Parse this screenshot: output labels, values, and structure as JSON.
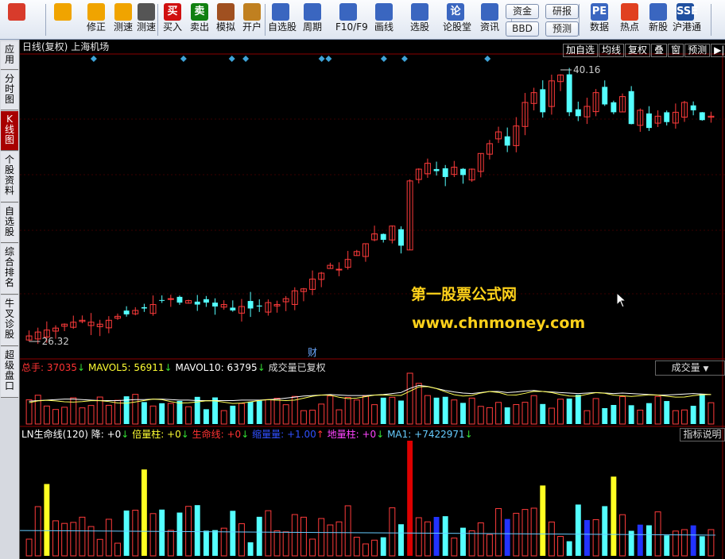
{
  "toolbar": {
    "items": [
      {
        "label": "",
        "icon": "home-icon",
        "color": "#d83b2b"
      },
      {
        "label": "",
        "icon": "back-arrow-icon",
        "color": "#f0a400"
      },
      {
        "label": "修正",
        "icon": "updown-arrows-icon",
        "color": "#f0a400"
      },
      {
        "label": "测速",
        "icon": "speed-icon",
        "color": "#f0a400"
      },
      {
        "label": "测速",
        "icon": "clock-icon",
        "color": "#555555"
      },
      {
        "label": "买入",
        "icon": "buy-icon",
        "text": "买",
        "color": "#d01010"
      },
      {
        "label": "卖出",
        "icon": "sell-icon",
        "text": "卖",
        "color": "#108010"
      },
      {
        "label": "模拟",
        "icon": "hammer-icon",
        "color": "#a05020"
      },
      {
        "label": "开户",
        "icon": "lock-icon",
        "color": "#c08020"
      },
      {
        "label": "自选股",
        "icon": "star-icon",
        "color": "#3a66c0"
      },
      {
        "label": "周期",
        "icon": "period-icon",
        "color": "#3a66c0"
      },
      {
        "label": "F10/F9",
        "icon": "f10-icon",
        "color": "#3a66c0"
      },
      {
        "label": "画线",
        "icon": "pencil-icon",
        "color": "#3a66c0"
      },
      {
        "label": "选股",
        "icon": "select-stock-icon",
        "color": "#3a66c0"
      },
      {
        "label": "论股堂",
        "icon": "forum-icon",
        "text": "论",
        "color": "#3a66c0"
      },
      {
        "label": "资讯",
        "icon": "news-icon",
        "color": "#3a66c0"
      },
      {
        "label": "数据",
        "icon": "pe-icon",
        "text": "PE",
        "color": "#3a66c0"
      },
      {
        "label": "热点",
        "icon": "hot-icon",
        "color": "#e04020"
      },
      {
        "label": "新股",
        "icon": "new-stock-icon",
        "color": "#3a66c0"
      },
      {
        "label": "沪港通",
        "icon": "sse-hkex-icon",
        "text": "SSE",
        "color": "#2050a0"
      }
    ],
    "pills": [
      "资金",
      "BBD",
      "研报",
      "预测"
    ]
  },
  "left_tabs": [
    "应用",
    "分时图",
    "K线图",
    "个股资料",
    "自选股",
    "综合排名",
    "牛叉诊股",
    "超级盘口"
  ],
  "chart_header": {
    "period": "日线(复权)",
    "stock": "上海机场"
  },
  "chart_buttons": [
    "加自选",
    "均线",
    "复权",
    "叠",
    "窗",
    "预测"
  ],
  "price_labels": {
    "high": "40.16",
    "low": "26.32"
  },
  "watermark": {
    "line1": "第一股票公式网",
    "line2": "www.chnmoney.com"
  },
  "event_marker": "财",
  "volume_header": {
    "total_label": "总手: ",
    "total": "37035",
    "total_arrow": "↓",
    "mavol5_label": "MAVOL5: ",
    "mavol5": "56911",
    "mavol5_arrow": "↓",
    "mavol10_label": "MAVOL10: ",
    "mavol10": "63795",
    "mavol10_arrow": "↓",
    "note": "成交量已复权",
    "select": "成交量"
  },
  "indicator_header": {
    "name": "LN生命线(120) 降: +0",
    "a1": "↓",
    "beiliang_label": "倍量柱: ",
    "beiliang": "+0",
    "a2": "↓",
    "life_label": "生命线: ",
    "life": "+0",
    "a3": "↓",
    "suoliang_label": "缩量量: ",
    "suoliang": "+1.00",
    "a4": "↑",
    "diliang_label": "地量柱: ",
    "diliang": "+0",
    "a5": "↓",
    "ma1_label": "MA1: ",
    "ma1": "+7422971",
    "a6": "↓",
    "help": "指标说明"
  },
  "chart_data": {
    "type": "candlestick",
    "high": 40.16,
    "low": 26.32,
    "close": [
      26.6,
      26.8,
      26.9,
      27.0,
      27.2,
      27.3,
      27.4,
      27.3,
      27.2,
      27.4,
      27.6,
      27.7,
      27.9,
      28.0,
      28.2,
      28.4,
      28.5,
      28.3,
      28.4,
      28.2,
      28.3,
      28.1,
      28.2,
      27.9,
      28.1,
      28.0,
      28.1,
      28.3,
      28.2,
      28.5,
      28.9,
      29.0,
      29.5,
      29.8,
      30.2,
      30.0,
      30.5,
      30.9,
      31.3,
      31.8,
      31.5,
      32.2,
      31.2,
      34.5,
      35.1,
      35.4,
      35.0,
      34.7,
      35.2,
      34.8,
      35.1,
      35.9,
      36.4,
      37.0,
      36.3,
      37.3,
      38.5,
      39.0,
      38.0,
      39.6,
      39.9,
      38.0,
      37.8,
      38.3,
      39.0,
      38.4,
      38.0,
      38.8,
      37.4,
      38.1,
      37.2,
      37.8,
      37.5,
      38.0,
      38.5,
      38.1,
      37.6,
      37.8
    ],
    "volume_ma": [
      45,
      46,
      47,
      48,
      49,
      49,
      48,
      47,
      46,
      46,
      46,
      47,
      48,
      48,
      49,
      49,
      48,
      47,
      47,
      46,
      46,
      46,
      46,
      46,
      47,
      47,
      47,
      48,
      49,
      51,
      53,
      55,
      56,
      57,
      58,
      57,
      56,
      56,
      56,
      57,
      58,
      60,
      62,
      70,
      76,
      74,
      70,
      66,
      63,
      61,
      60,
      62,
      64,
      64,
      62,
      63,
      65,
      66,
      64,
      63,
      62,
      61,
      60,
      61,
      62,
      61,
      60,
      61,
      60,
      59,
      58,
      57,
      57,
      58,
      59,
      60,
      59,
      58
    ]
  }
}
